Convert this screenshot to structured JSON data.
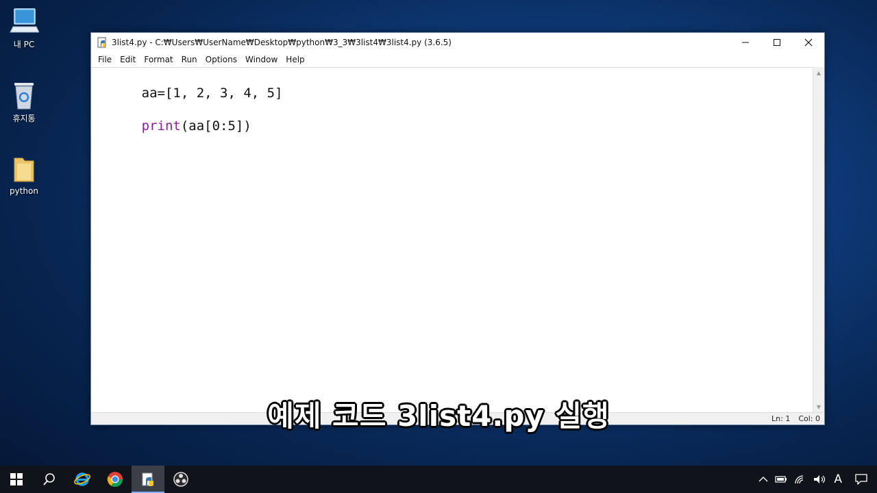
{
  "desktop": {
    "icons": [
      {
        "label": "내 PC",
        "icon": "computer-icon"
      },
      {
        "label": "휴지통",
        "icon": "recycle-bin-icon"
      },
      {
        "label": "python",
        "icon": "folder-icon"
      }
    ]
  },
  "window": {
    "title": "3list4.py - C:₩Users₩UserName₩Desktop₩python₩3_3₩3list4₩3list4.py (3.6.5)",
    "menu": [
      "File",
      "Edit",
      "Format",
      "Run",
      "Options",
      "Window",
      "Help"
    ],
    "code": {
      "line1": "aa=[1, 2, 3, 4, 5]",
      "line3_keyword": "print",
      "line3_rest": "(aa[0:5])"
    },
    "status": {
      "line": "Ln: 1",
      "col": "Col: 0"
    }
  },
  "subtitle": "예제 코드 3list4.py 실행",
  "taskbar": {
    "apps": [
      "windows-start-icon",
      "search-icon",
      "internet-explorer-icon",
      "chrome-icon",
      "python-idle-icon",
      "obs-icon"
    ],
    "tray": {
      "language": "A",
      "icons": [
        "chevron-up-icon",
        "battery-icon",
        "network-icon",
        "volume-icon",
        "notification-icon"
      ]
    }
  },
  "colors": {
    "keyword": "#8b1a9e",
    "taskbar": "#101319"
  }
}
